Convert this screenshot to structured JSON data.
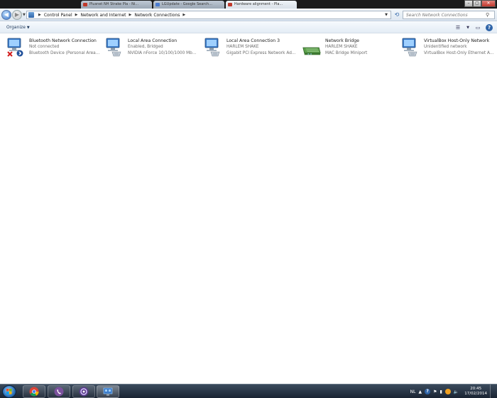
{
  "browser_tabs": [
    {
      "label": "Plusnet NH Strake Pla - Ni..."
    },
    {
      "label": "LGUpdate - Google Search..."
    },
    {
      "label": "Hardware alignment - Pla..."
    }
  ],
  "window_controls": {
    "minimize": "–",
    "maximize": "▢",
    "close": "✕"
  },
  "address_bar": {
    "breadcrumbs": [
      "Control Panel",
      "Network and Internet",
      "Network Connections"
    ],
    "search_placeholder": "Search Network Connections"
  },
  "command_bar": {
    "organize_label": "Organize"
  },
  "connections": [
    {
      "name": "Bluetooth Network Connection",
      "status": "Not connected",
      "device": "Bluetooth Device (Personal Area ...",
      "icon": "network-adapter-disconnected-bluetooth"
    },
    {
      "name": "Local Area Connection",
      "status": "Enabled, Bridged",
      "device": "NVIDIA nForce 10/100/1000 Mbps...",
      "icon": "network-adapter"
    },
    {
      "name": "Local Area Connection 3",
      "status": "HARLEM SHAKE",
      "device": "Gigabit PCI Express Network Ada...",
      "icon": "network-adapter"
    },
    {
      "name": "Network Bridge",
      "status": "HARLEM SHAKE",
      "device": "MAC Bridge Miniport",
      "icon": "network-bridge"
    },
    {
      "name": "VirtualBox Host-Only Network",
      "status": "Unidentified network",
      "device": "VirtualBox Host-Only Ethernet Ad...",
      "icon": "network-adapter"
    }
  ],
  "taskbar": {
    "apps": [
      "chrome",
      "viber",
      "torrent-client",
      "network-connections-window"
    ],
    "tray": {
      "language": "NL",
      "time": "20:45",
      "date": "17/02/2014"
    }
  },
  "colors": {
    "accent": "#2f64a8",
    "taskbar": "#1a2433",
    "disconnected_x": "#d21c1c"
  }
}
